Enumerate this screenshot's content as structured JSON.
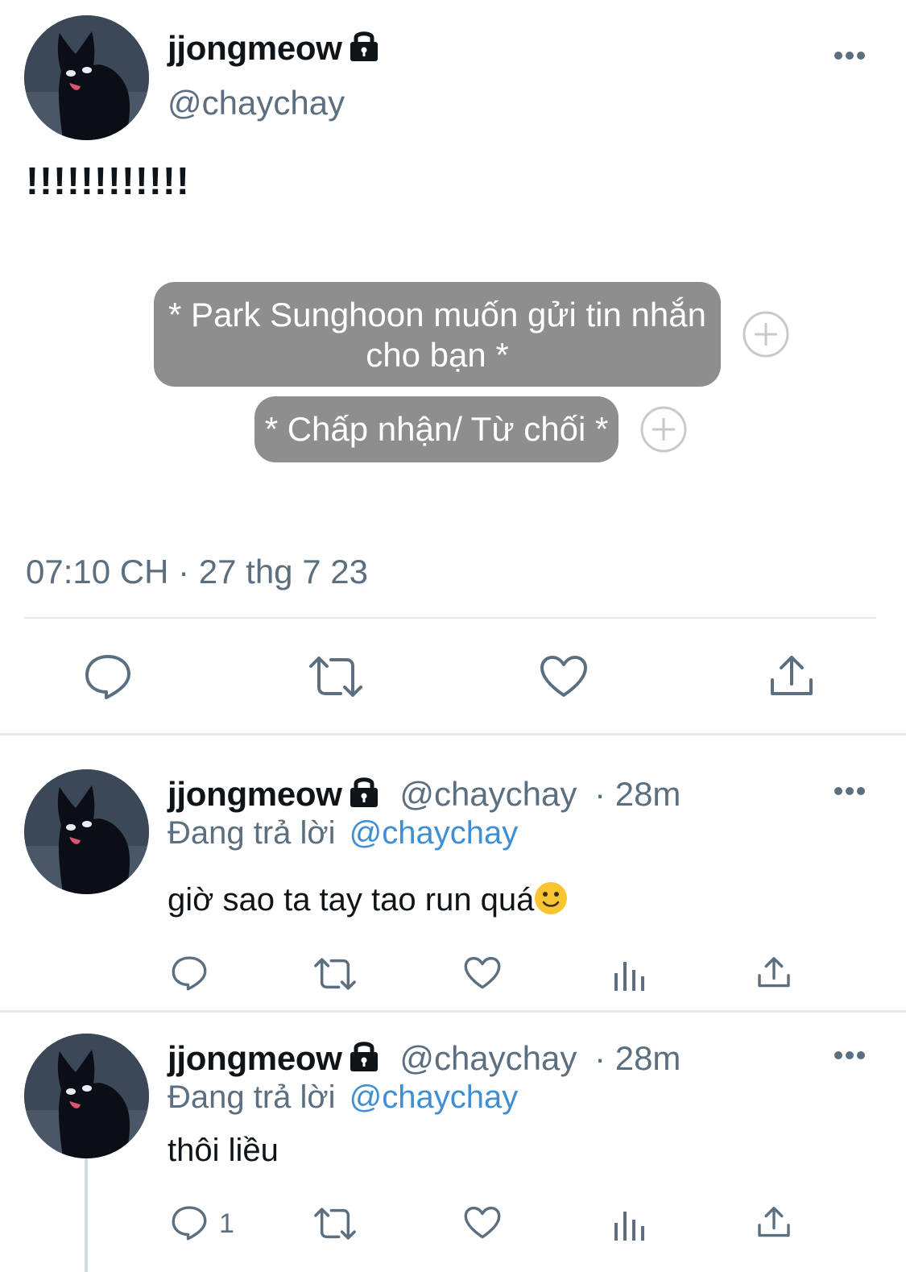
{
  "main_tweet": {
    "display_name": "jjongmeow",
    "handle": "@chaychay",
    "text": "!!!!!!!!!!!!",
    "bubble_1": "* Park Sunghoon muốn gửi tin nhắn cho bạn *",
    "bubble_2": "* Chấp nhận/ Từ chối *",
    "timestamp": "07:10 CH · 27 thg 7 23",
    "icons": [
      "more-icon",
      "lock-icon",
      "plus-icon",
      "reply-icon",
      "retweet-icon",
      "like-icon",
      "share-icon"
    ]
  },
  "replies": [
    {
      "display_name": "jjongmeow",
      "handle": "@chaychay",
      "time": "· 28m",
      "replying_prefix": "Đang trả lời",
      "replying_to": "@chaychay",
      "text": "giờ sao ta tay tao run quá",
      "emoji": "smiley-icon",
      "reply_count": ""
    },
    {
      "display_name": "jjongmeow",
      "handle": "@chaychay",
      "time": "· 28m",
      "replying_prefix": "Đang trả lời",
      "replying_to": "@chaychay",
      "text": "thôi liều",
      "reply_count": "1"
    }
  ],
  "colors": {
    "text": "#0f1419",
    "secondary": "#5b6f80",
    "link": "#3e8fd3",
    "bubble": "#8e8e8e",
    "divider": "#e4e8eb"
  }
}
